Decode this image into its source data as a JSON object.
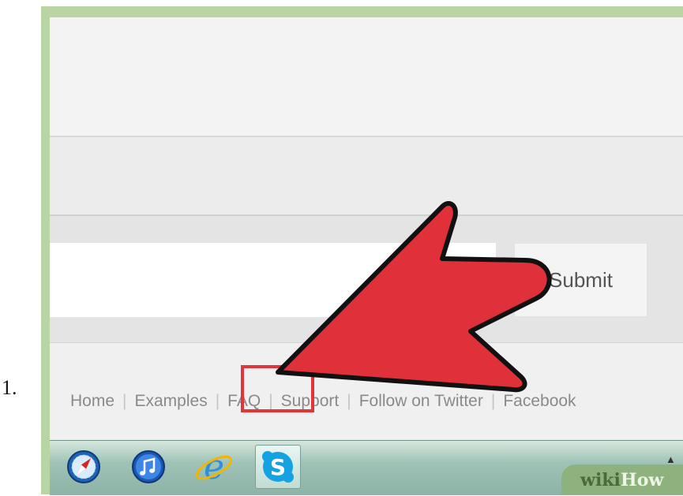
{
  "list_number": "1.",
  "form": {
    "url_placeholder": "",
    "submit_label": "Submit"
  },
  "footer_nav": [
    {
      "label": "Home"
    },
    {
      "label": "Examples"
    },
    {
      "label": "FAQ"
    },
    {
      "label": "Support"
    },
    {
      "label": "Follow on Twitter"
    },
    {
      "label": "Facebook"
    }
  ],
  "taskbar": {
    "icons": [
      "safari-icon",
      "itunes-icon",
      "internet-explorer-icon",
      "skype-icon"
    ],
    "active_icon": "skype-icon"
  },
  "watermark": {
    "wiki": "wiki",
    "how": "How"
  },
  "colors": {
    "arrow": "#e0303a",
    "highlight_box": "#e0363b",
    "frame": "#b9d5a4",
    "taskbar": "#9fc3b6"
  }
}
